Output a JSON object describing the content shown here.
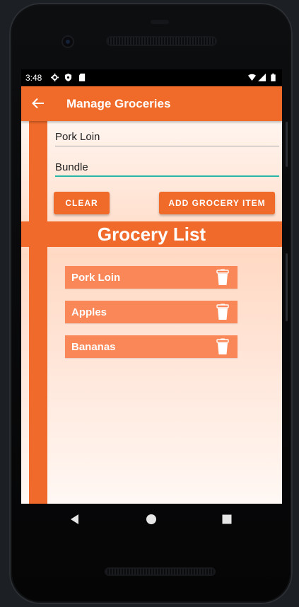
{
  "status_bar": {
    "time": "3:48",
    "icons": [
      "settings-icon",
      "shield-icon",
      "sd-card-icon",
      "wifi-icon",
      "signal-icon",
      "battery-icon"
    ]
  },
  "app_bar": {
    "title": "Manage Groceries",
    "back_icon": "back-arrow-icon"
  },
  "form": {
    "name_value": "Pork Loin",
    "unit_value": "Bundle",
    "clear_label": "CLEAR",
    "add_label": "ADD GROCERY ITEM"
  },
  "list": {
    "header": "Grocery List",
    "items": [
      {
        "label": "Pork Loin",
        "icon": "trash-icon"
      },
      {
        "label": "Apples",
        "icon": "trash-icon"
      },
      {
        "label": "Bananas",
        "icon": "trash-icon"
      }
    ]
  },
  "nav_bar": {
    "icons": [
      "back-triangle-icon",
      "home-circle-icon",
      "recents-square-icon"
    ]
  },
  "colors": {
    "accent": "#f06a2a",
    "list_item": "#f98757",
    "focus_line": "#27b6a7"
  }
}
